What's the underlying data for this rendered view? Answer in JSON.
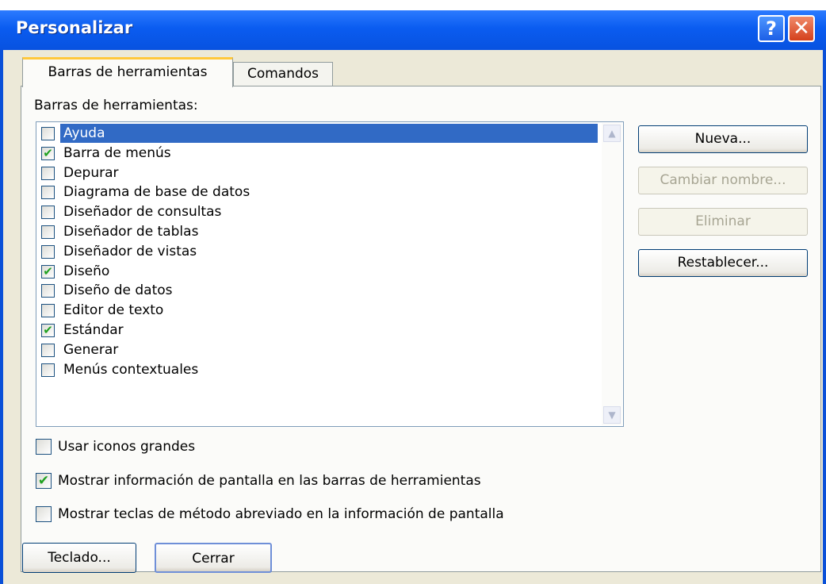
{
  "window": {
    "title": "Personalizar",
    "help_glyph": "?",
    "close_glyph": "✕",
    "title_color": "#0a5cf0"
  },
  "tabs": [
    {
      "label": "Barras de herramientas",
      "active": true
    },
    {
      "label": "Comandos",
      "active": false
    }
  ],
  "toolbars_section": {
    "label": "Barras de herramientas:",
    "items": [
      {
        "label": "Ayuda",
        "checked": false,
        "selected": true
      },
      {
        "label": "Barra de menús",
        "checked": true,
        "selected": false
      },
      {
        "label": "Depurar",
        "checked": false,
        "selected": false
      },
      {
        "label": "Diagrama de base de datos",
        "checked": false,
        "selected": false
      },
      {
        "label": "Diseñador de consultas",
        "checked": false,
        "selected": false
      },
      {
        "label": "Diseñador de tablas",
        "checked": false,
        "selected": false
      },
      {
        "label": "Diseñador de vistas",
        "checked": false,
        "selected": false
      },
      {
        "label": "Diseño",
        "checked": true,
        "selected": false
      },
      {
        "label": "Diseño de datos",
        "checked": false,
        "selected": false
      },
      {
        "label": "Editor de texto",
        "checked": false,
        "selected": false
      },
      {
        "label": "Estándar",
        "checked": true,
        "selected": false
      },
      {
        "label": "Generar",
        "checked": false,
        "selected": false
      },
      {
        "label": "Menús contextuales",
        "checked": false,
        "selected": false
      }
    ]
  },
  "side_buttons": {
    "new": "Nueva...",
    "rename": "Cambiar nombre...",
    "delete": "Eliminar",
    "reset": "Restablecer..."
  },
  "options": {
    "large_icons": {
      "label": "Usar iconos grandes",
      "checked": false
    },
    "show_tooltips": {
      "label": "Mostrar información de pantalla en las barras de herramientas",
      "checked": true
    },
    "show_shortcuts": {
      "label": "Mostrar teclas de método abreviado en la información de pantalla",
      "checked": false
    }
  },
  "footer": {
    "keyboard": "Teclado...",
    "close": "Cerrar"
  },
  "icons": {
    "check": "✔",
    "scroll_up": "▲",
    "scroll_down": "▼"
  }
}
